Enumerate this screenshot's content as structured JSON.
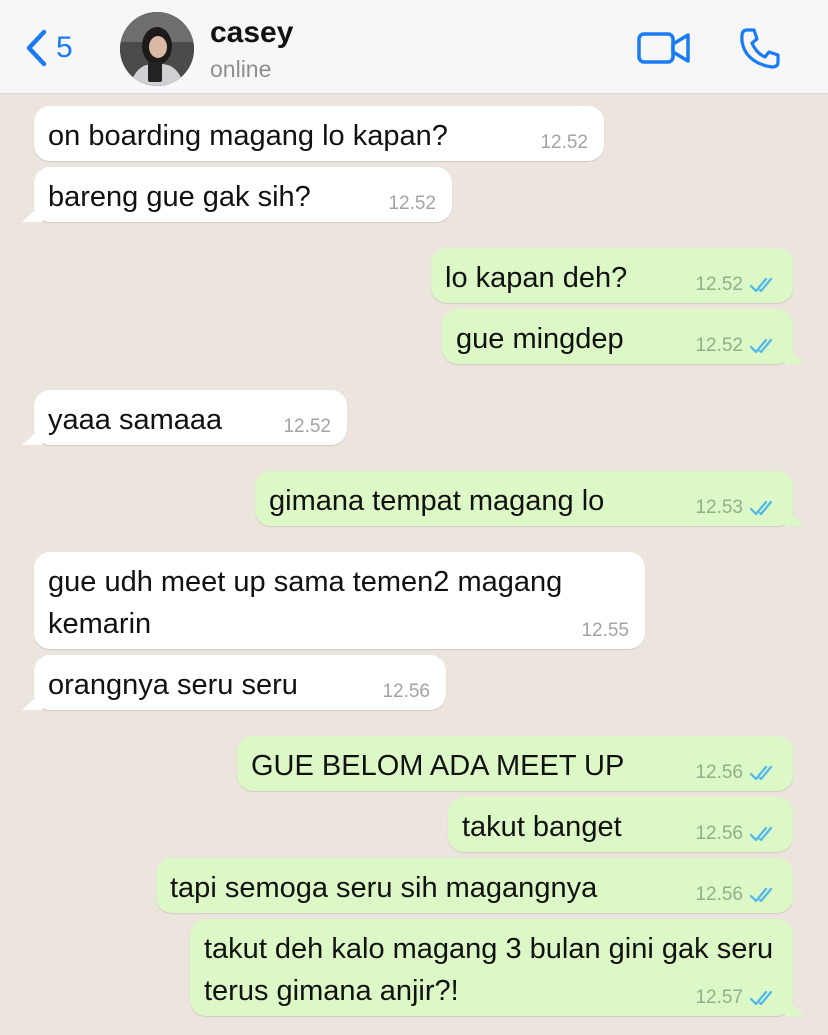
{
  "header": {
    "back_count": "5",
    "contact_name": "casey",
    "contact_status": "online"
  },
  "colors": {
    "accent": "#1a7cf5",
    "incoming_bubble": "#ffffff",
    "outgoing_bubble": "#dcf8c6",
    "chat_background": "#ece5dd",
    "read_ticks": "#4fb6ec"
  },
  "icons": [
    "chevron-left-icon",
    "video-call-icon",
    "phone-icon",
    "double-check-icon"
  ],
  "messages": [
    {
      "dir": "in",
      "text": "on boarding magang lo kapan?",
      "time": "12.52"
    },
    {
      "dir": "in",
      "text": "bareng gue gak sih?",
      "time": "12.52"
    },
    {
      "dir": "out",
      "text": "lo kapan deh?",
      "time": "12.52",
      "status": "read"
    },
    {
      "dir": "out",
      "text": "gue mingdep",
      "time": "12.52",
      "status": "read"
    },
    {
      "dir": "in",
      "text": "yaaa samaaa",
      "time": "12.52"
    },
    {
      "dir": "out",
      "text": "gimana tempat magang lo",
      "time": "12.53",
      "status": "read"
    },
    {
      "dir": "in",
      "text": "gue udh meet up sama temen2 magang kemarin",
      "time": "12.55"
    },
    {
      "dir": "in",
      "text": "orangnya seru seru",
      "time": "12.56"
    },
    {
      "dir": "out",
      "text": "GUE BELOM ADA MEET UP",
      "time": "12.56",
      "status": "read"
    },
    {
      "dir": "out",
      "text": "takut banget",
      "time": "12.56",
      "status": "read"
    },
    {
      "dir": "out",
      "text": "tapi semoga seru sih magangnya",
      "time": "12.56",
      "status": "read"
    },
    {
      "dir": "out",
      "text": "takut deh kalo magang 3 bulan gini gak seru terus gimana anjir?!",
      "time": "12.57",
      "status": "read"
    }
  ]
}
